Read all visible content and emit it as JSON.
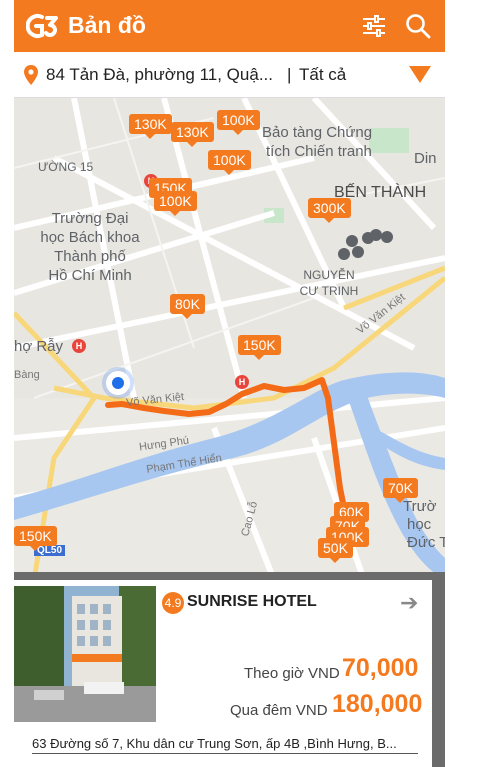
{
  "header": {
    "title": "Bản đồ",
    "logo_icon": "app-logo",
    "filter_icon": "filter-sliders-icon",
    "search_icon": "search-icon",
    "bg_color": "#f47a1f"
  },
  "searchbar": {
    "address": "84 Tản Đà, phường 11, Quậ...",
    "separator": "|",
    "category": "Tất cả"
  },
  "map": {
    "labels": {
      "ben_thanh": "BẾN THÀNH",
      "nguyen_cu_trinh_1": "NGUYỄN",
      "nguyen_cu_trinh_2": "CƯ TRINH",
      "bk_1": "Trường Đại",
      "bk_2": "học Bách khoa",
      "bk_3": "Thành phố",
      "bk_4": "Hồ Chí Minh",
      "museum_1": "Bảo tàng Chứng",
      "museum_2": "tích Chiến tranh",
      "din": "Din",
      "cho_ray": "hợ Rẫy",
      "phuong15": "ƯỜNG 15",
      "truong_hoc_1": "Trườ",
      "truong_hoc_2": "học",
      "truong_hoc_3": "Đức T",
      "street_vo_van_kiet": "Võ Văn Kiệt",
      "street_vo_van_kiet_2": "Võ Văn Kiệt",
      "street_hung_phu": "Hưng Phú",
      "street_pham_the_hien": "Phạm Thế Hiển",
      "street_cao_lo": "Cao Lỗ",
      "street_bang": "Bàng",
      "road_ql50": "QL50"
    },
    "prices": [
      "130K",
      "130K",
      "100K",
      "100K",
      "150K",
      "100K",
      "300K",
      "80K",
      "150K",
      "70K",
      "60K",
      "70K",
      "100K",
      "50K",
      "150K"
    ]
  },
  "hotel": {
    "rating": "4.9",
    "name": "SUNRISE HOTEL",
    "hourly_label": "Theo giờ VND",
    "hourly_price": "70,000",
    "overnight_label": "Qua đêm VND",
    "overnight_price": "180,000",
    "address": "63 Đường số 7, Khu dân cư Trung Sơn, ấp 4B ,Bình Hưng, B..."
  }
}
